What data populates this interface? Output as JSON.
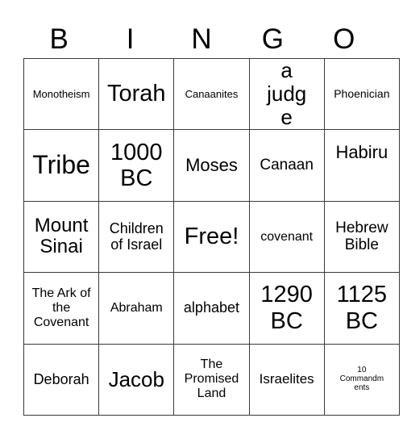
{
  "card": {
    "header": [
      "B",
      "I",
      "N",
      "G",
      "O"
    ],
    "rows": [
      [
        "Monotheism",
        "Torah",
        "Canaanites",
        "a judge",
        "Phoenician"
      ],
      [
        "Tribe",
        "1000 BC",
        "Moses",
        "Canaan",
        "Habiru"
      ],
      [
        "Mount Sinai",
        "Children of Israel",
        "Free!",
        "covenant",
        "Hebrew Bible"
      ],
      [
        "The Ark of the Covenant",
        "Abraham",
        "alphabet",
        "1290 BC",
        "1125 BC"
      ],
      [
        "Deborah",
        "Jacob",
        "The Promised Land",
        "Israelites",
        "10 Commandments"
      ]
    ],
    "free_space": "Free!"
  }
}
